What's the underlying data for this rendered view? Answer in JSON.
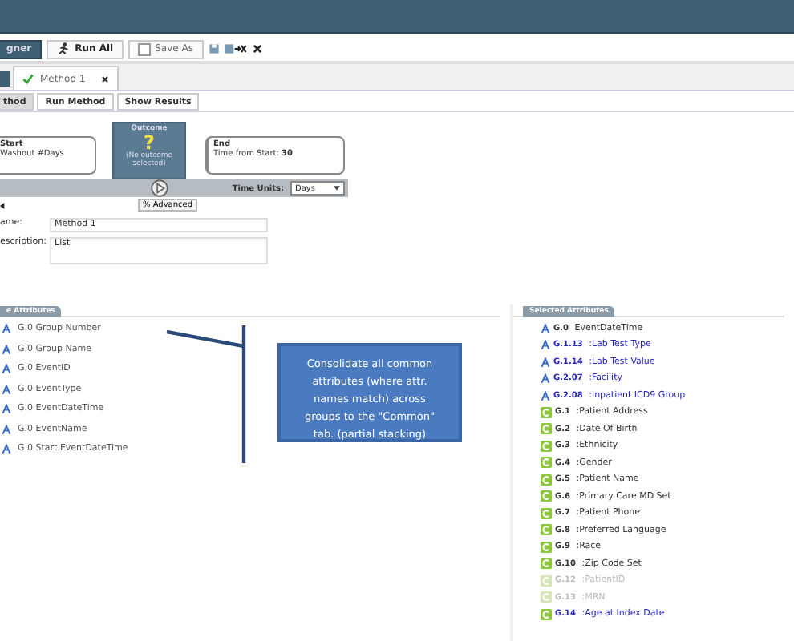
{
  "toolbar": {
    "buttons": [
      {
        "label": "gner",
        "kind": "dark"
      },
      {
        "label": "Run All",
        "kind": "run"
      },
      {
        "label": "Save As",
        "kind": "check"
      }
    ]
  },
  "tabs": [
    {
      "label": "Method 1",
      "selected": true,
      "valid": true
    }
  ],
  "subtabs": [
    {
      "label": "thod",
      "selected": true
    },
    {
      "label": "Run Method",
      "selected": false
    },
    {
      "label": "Show Results",
      "selected": false
    }
  ],
  "timeline": {
    "start": {
      "title": "Start",
      "detail": "Washout #Days"
    },
    "outcome": {
      "title": "Outcome",
      "symbol": "?",
      "detail": "(No outcome selected)"
    },
    "end": {
      "title": "End",
      "detail": "Time from Start:",
      "value": "30"
    },
    "time_units": {
      "label": "Time Units:",
      "value": "Days"
    },
    "advanced_button": "% Advanced"
  },
  "form": [
    {
      "label": "ame:",
      "value": "Method 1",
      "kind": "line"
    },
    {
      "label": "escription:",
      "value": "List",
      "kind": "area"
    }
  ],
  "available": {
    "title": "e Attributes",
    "items": [
      {
        "code": "G.0",
        "name": "Group Number"
      },
      {
        "code": "G.0",
        "name": "Group Name"
      },
      {
        "code": "G.0",
        "name": "EventID"
      },
      {
        "code": "G.0",
        "name": "EventType"
      },
      {
        "code": "G.0",
        "name": "EventDateTime"
      },
      {
        "code": "G.0",
        "name": "EventName"
      },
      {
        "code": "G.0",
        "name": "Start EventDateTime"
      }
    ]
  },
  "callout": "Consolidate all  common attributes (where attr. names match) across groups to the \"Common\" tab.  (partial stacking)",
  "selected": {
    "title": "Selected Attributes",
    "items": [
      {
        "kind": "attribute",
        "code": "G.0",
        "name": "EventDateTime",
        "highlighted": false,
        "disabled": false
      },
      {
        "kind": "attribute",
        "code": "G.1.13",
        "name": ":Lab Test Type",
        "highlighted": true,
        "disabled": false
      },
      {
        "kind": "attribute",
        "code": "G.1.14",
        "name": ":Lab Test Value",
        "highlighted": true,
        "disabled": false
      },
      {
        "kind": "attribute",
        "code": "G.2.07",
        "name": ":Facility",
        "highlighted": true,
        "disabled": false
      },
      {
        "kind": "attribute",
        "code": "G.2.08",
        "name": ":Inpatient ICD9 Group",
        "highlighted": true,
        "disabled": false
      },
      {
        "kind": "common",
        "code": "G.1",
        "name": ":Patient Address",
        "highlighted": false,
        "disabled": false
      },
      {
        "kind": "common",
        "code": "G.2",
        "name": ":Date Of Birth",
        "highlighted": false,
        "disabled": false
      },
      {
        "kind": "common",
        "code": "G.3",
        "name": ":Ethnicity",
        "highlighted": false,
        "disabled": false
      },
      {
        "kind": "common",
        "code": "G.4",
        "name": ":Gender",
        "highlighted": false,
        "disabled": false
      },
      {
        "kind": "common",
        "code": "G.5",
        "name": ":Patient Name",
        "highlighted": false,
        "disabled": false
      },
      {
        "kind": "common",
        "code": "G.6",
        "name": ":Primary Care MD Set",
        "highlighted": false,
        "disabled": false
      },
      {
        "kind": "common",
        "code": "G.7",
        "name": ":Patient Phone",
        "highlighted": false,
        "disabled": false
      },
      {
        "kind": "common",
        "code": "G.8",
        "name": ":Preferred Language",
        "highlighted": false,
        "disabled": false
      },
      {
        "kind": "common",
        "code": "G.9",
        "name": ":Race",
        "highlighted": false,
        "disabled": false
      },
      {
        "kind": "common",
        "code": "G.10",
        "name": ":Zip Code Set",
        "highlighted": false,
        "disabled": false
      },
      {
        "kind": "common",
        "code": "G.12",
        "name": ":PatientID",
        "highlighted": false,
        "disabled": true
      },
      {
        "kind": "common",
        "code": "G.13",
        "name": ":MRN",
        "highlighted": false,
        "disabled": true
      },
      {
        "kind": "common",
        "code": "G.14",
        "name": ":Age at Index Date",
        "highlighted": true,
        "disabled": false
      }
    ]
  }
}
